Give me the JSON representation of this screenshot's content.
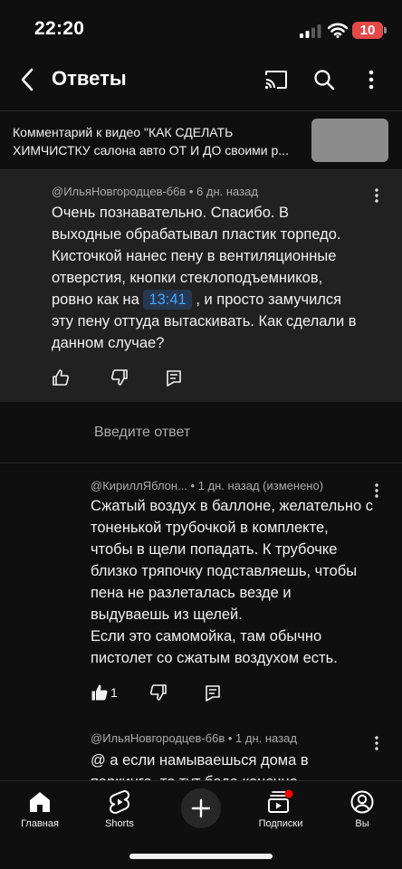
{
  "status": {
    "time": "22:20",
    "battery": "10"
  },
  "header": {
    "title": "Ответы"
  },
  "video_ref": {
    "line1": "Комментарий к видео \"КАК СДЕЛАТЬ",
    "line2": "ХИМЧИСТКУ салона авто ОТ И ДО своими р..."
  },
  "main_comment": {
    "meta": "@ИльяНовгородцев-б6в • 6 дн. назад",
    "text_before": "Очень познавательно. Спасибо. В выходные обрабатывал пластик торпедо. Кисточкой нанес пену в вентиляционные отверстия, кнопки стеклоподъемников, ровно как на ",
    "timestamp": "13:41",
    "text_after": " , и просто замучился эту пену оттуда вытаскивать. Как сделали в данном случае?"
  },
  "reply_input": {
    "placeholder": "Введите ответ"
  },
  "replies": [
    {
      "meta": "@КириллЯблон... • 1 дн. назад (изменено)",
      "text": "Сжатый воздух в баллоне, желательно с тоненькой трубочкой в комплекте, чтобы в щели попадать. К трубочке близко тряпочку подставляешь, чтобы пена не разлеталась везде и выдуваешь из щелей.\nЕсли это самомойка, там обычно пистолет со сжатым воздухом есть.",
      "likes": "1"
    },
    {
      "meta": "@ИльяНовгородцев-б6в • 1 дн. назад",
      "text": "@ а если намываешься дома в паркинге, то тут беда конечно"
    }
  ],
  "nav": {
    "home": "Главная",
    "shorts": "Shorts",
    "subscriptions": "Подписки",
    "you": "Вы"
  },
  "colors": {
    "background": "#0f0f0f",
    "highlight": "#212121",
    "timestamp_link": "#3ea6ff",
    "notification_dot": "#ff0000",
    "battery": "#e34949"
  }
}
